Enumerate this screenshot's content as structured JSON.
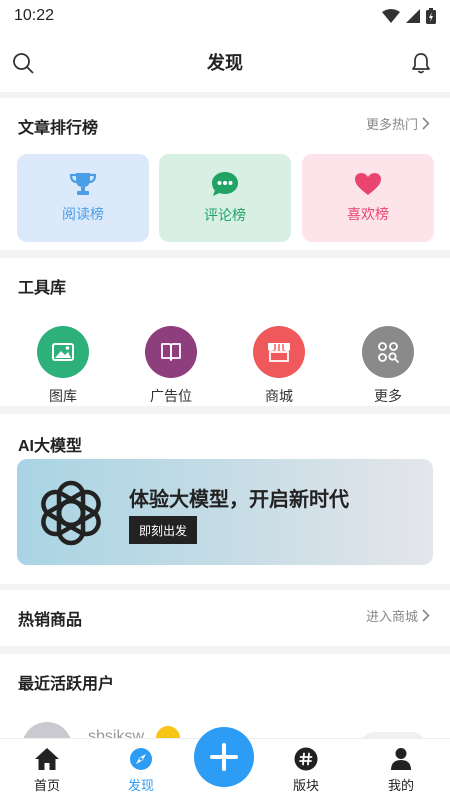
{
  "status_bar": {
    "time": "10:22"
  },
  "header": {
    "title": "发现"
  },
  "ranking": {
    "title": "文章排行榜",
    "more": "更多热门",
    "cards": [
      {
        "label": "阅读榜",
        "color": "#4a9ee8",
        "bg": "#dbe9fb",
        "icon": "trophy-icon"
      },
      {
        "label": "评论榜",
        "color": "#21a366",
        "bg": "#d8efe4",
        "icon": "chat-icon"
      },
      {
        "label": "喜欢榜",
        "color": "#e9456e",
        "bg": "#fde3ea",
        "icon": "heart-icon"
      }
    ]
  },
  "tools": {
    "title": "工具库",
    "items": [
      {
        "label": "图库",
        "color": "#2db07a",
        "icon": "image-icon"
      },
      {
        "label": "广告位",
        "color": "#8e3d7d",
        "icon": "book-icon"
      },
      {
        "label": "商城",
        "color": "#f0595b",
        "icon": "store-icon"
      },
      {
        "label": "更多",
        "color": "#8a8a8a",
        "icon": "grid-search-icon"
      }
    ]
  },
  "ai": {
    "title": "AI大模型",
    "headline": "体验大模型，开启新时代",
    "cta": "即刻出发"
  },
  "products": {
    "title": "热销商品",
    "more": "进入商城"
  },
  "active_users": {
    "title": "最近活跃用户",
    "first_user": {
      "name": "sbsjksw"
    }
  },
  "bottom_nav": [
    {
      "label": "首页",
      "icon": "home-icon"
    },
    {
      "label": "发现",
      "icon": "compass-icon",
      "active": true
    },
    {
      "label": "版块",
      "icon": "hash-icon"
    },
    {
      "label": "我的",
      "icon": "user-icon"
    }
  ],
  "colors": {
    "accent": "#2c9cf5"
  }
}
